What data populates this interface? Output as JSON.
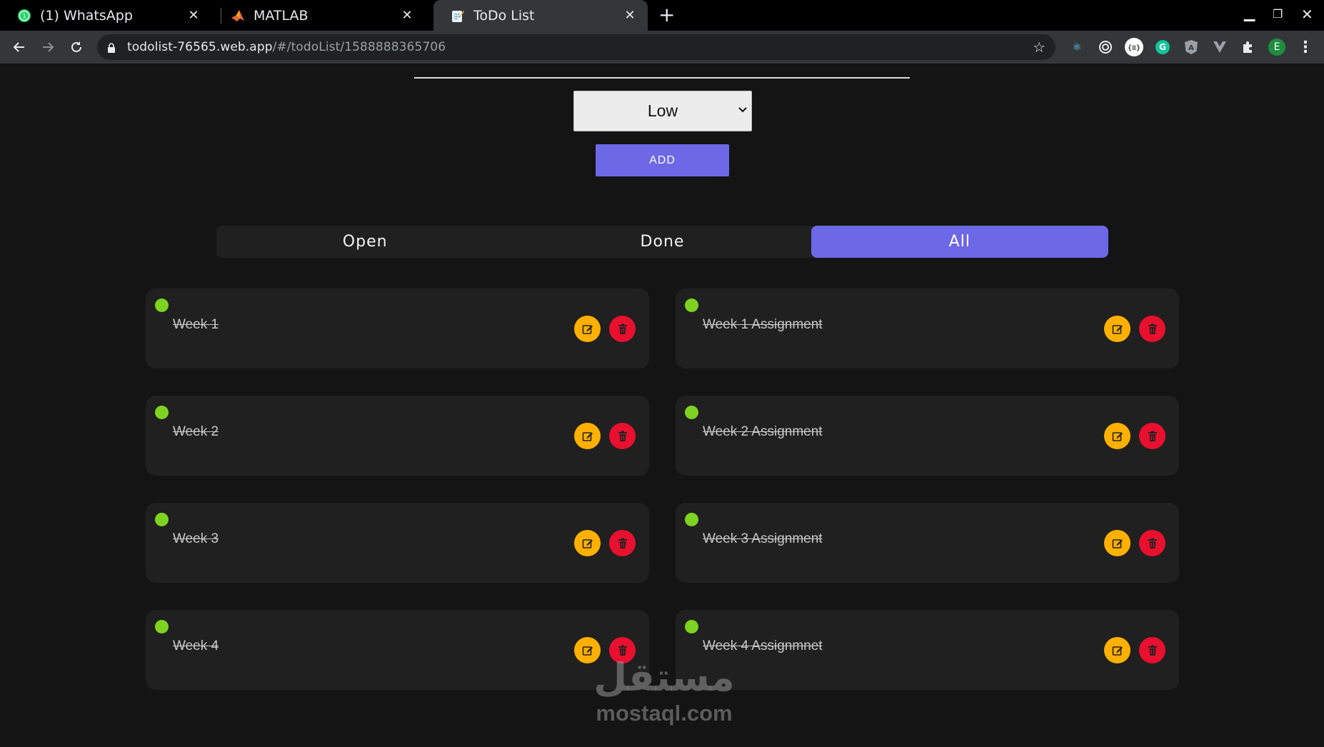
{
  "browser": {
    "tabs": [
      {
        "title": "(1) WhatsApp",
        "active": false,
        "icon": "whatsapp-icon",
        "badge": "1"
      },
      {
        "title": "MATLAB",
        "active": false,
        "icon": "matlab-icon"
      },
      {
        "title": "ToDo List",
        "active": true,
        "icon": "notepad-icon"
      }
    ],
    "url_host": "todolist-76565.web.app",
    "url_path": "/#/todoList/1588888365706",
    "profile_initial": "E"
  },
  "form": {
    "priority_value": "Low",
    "add_label": "ADD"
  },
  "filters": [
    {
      "label": "Open",
      "active": false
    },
    {
      "label": "Done",
      "active": false
    },
    {
      "label": "All",
      "active": true
    }
  ],
  "tasks": [
    {
      "title": "Week 1",
      "done": true,
      "status_color": "#7ed321"
    },
    {
      "title": "Week 1 Assignment",
      "done": true,
      "status_color": "#7ed321"
    },
    {
      "title": "Week 2",
      "done": true,
      "status_color": "#7ed321"
    },
    {
      "title": "Week 2 Assignment",
      "done": true,
      "status_color": "#7ed321"
    },
    {
      "title": "Week 3",
      "done": true,
      "status_color": "#7ed321"
    },
    {
      "title": "Week 3 Assignment",
      "done": true,
      "status_color": "#7ed321"
    },
    {
      "title": "Week 4",
      "done": true,
      "status_color": "#7ed321"
    },
    {
      "title": "Week 4 Assignmnet",
      "done": true,
      "status_color": "#7ed321"
    }
  ],
  "watermark": {
    "arabic": "مستقل",
    "latin": "mostaql.com"
  },
  "colors": {
    "accent": "#6c68e6",
    "edit": "#ffb000",
    "delete": "#e8102e",
    "status_done": "#7ed321"
  }
}
